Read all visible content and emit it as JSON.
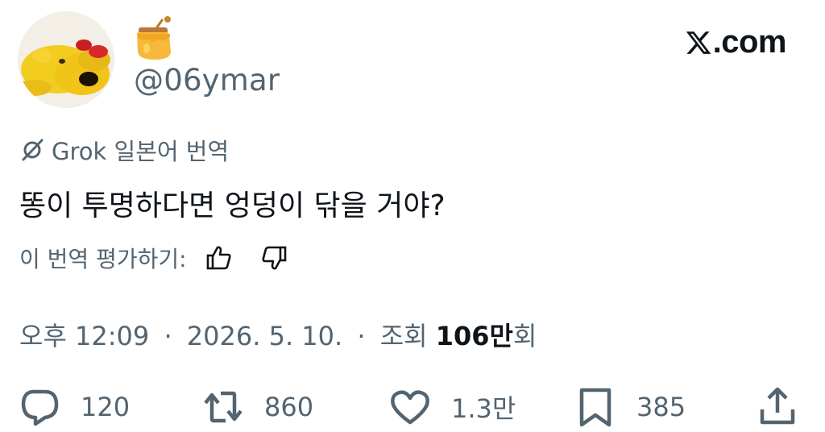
{
  "author": {
    "display_name_icon": "honey-pot-icon",
    "handle": "@06ymar",
    "avatar": "plush-toy-avatar"
  },
  "site": {
    "logo_text": ".com"
  },
  "translation": {
    "label": "Grok 일본어 번역",
    "icon": "grok-icon"
  },
  "tweet": {
    "text": "똥이 투명하다면 엉덩이 닦을 거야?"
  },
  "rating": {
    "label": "이 번역 평가하기:"
  },
  "meta": {
    "time": "오후 12:09",
    "separator": "·",
    "date": "2026. 5. 10.",
    "views_prefix": "조회",
    "views_count": "106만",
    "views_suffix": "회"
  },
  "actions": {
    "reply_count": "120",
    "repost_count": "860",
    "like_count": "1.3만",
    "bookmark_count": "385"
  },
  "colors": {
    "text": "#0f1419",
    "secondary": "#536471"
  }
}
